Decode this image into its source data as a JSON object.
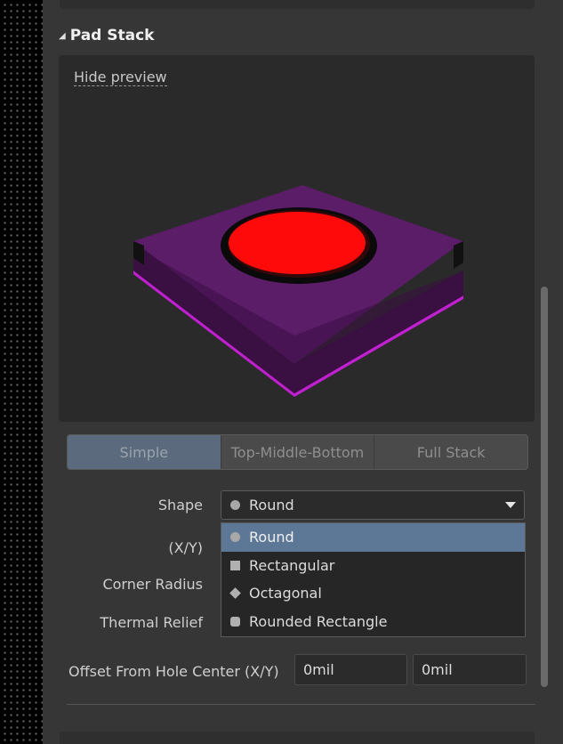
{
  "section": {
    "title": "Pad Stack"
  },
  "preview": {
    "hide_label": "Hide preview"
  },
  "tabs": [
    {
      "label": "Simple",
      "active": true
    },
    {
      "label": "Top-Middle-Bottom",
      "active": false
    },
    {
      "label": "Full Stack",
      "active": false
    }
  ],
  "form": {
    "shape_label": "Shape",
    "xy_label": "(X/Y)",
    "corner_radius_label": "Corner Radius",
    "thermal_relief_label": "Thermal Relief",
    "shape_value": "Round",
    "shape_options": [
      "Round",
      "Rectangular",
      "Octagonal",
      "Rounded Rectangle"
    ],
    "selected_option": "Round",
    "offset_label": "Offset From Hole Center (X/Y)",
    "offset_x": "0mil",
    "offset_y": "0mil"
  },
  "colors": {
    "pad": "#ff0a0a",
    "solder_mask": "#5a1a66",
    "edge": "#c020d0",
    "selection": "#5d7896"
  }
}
